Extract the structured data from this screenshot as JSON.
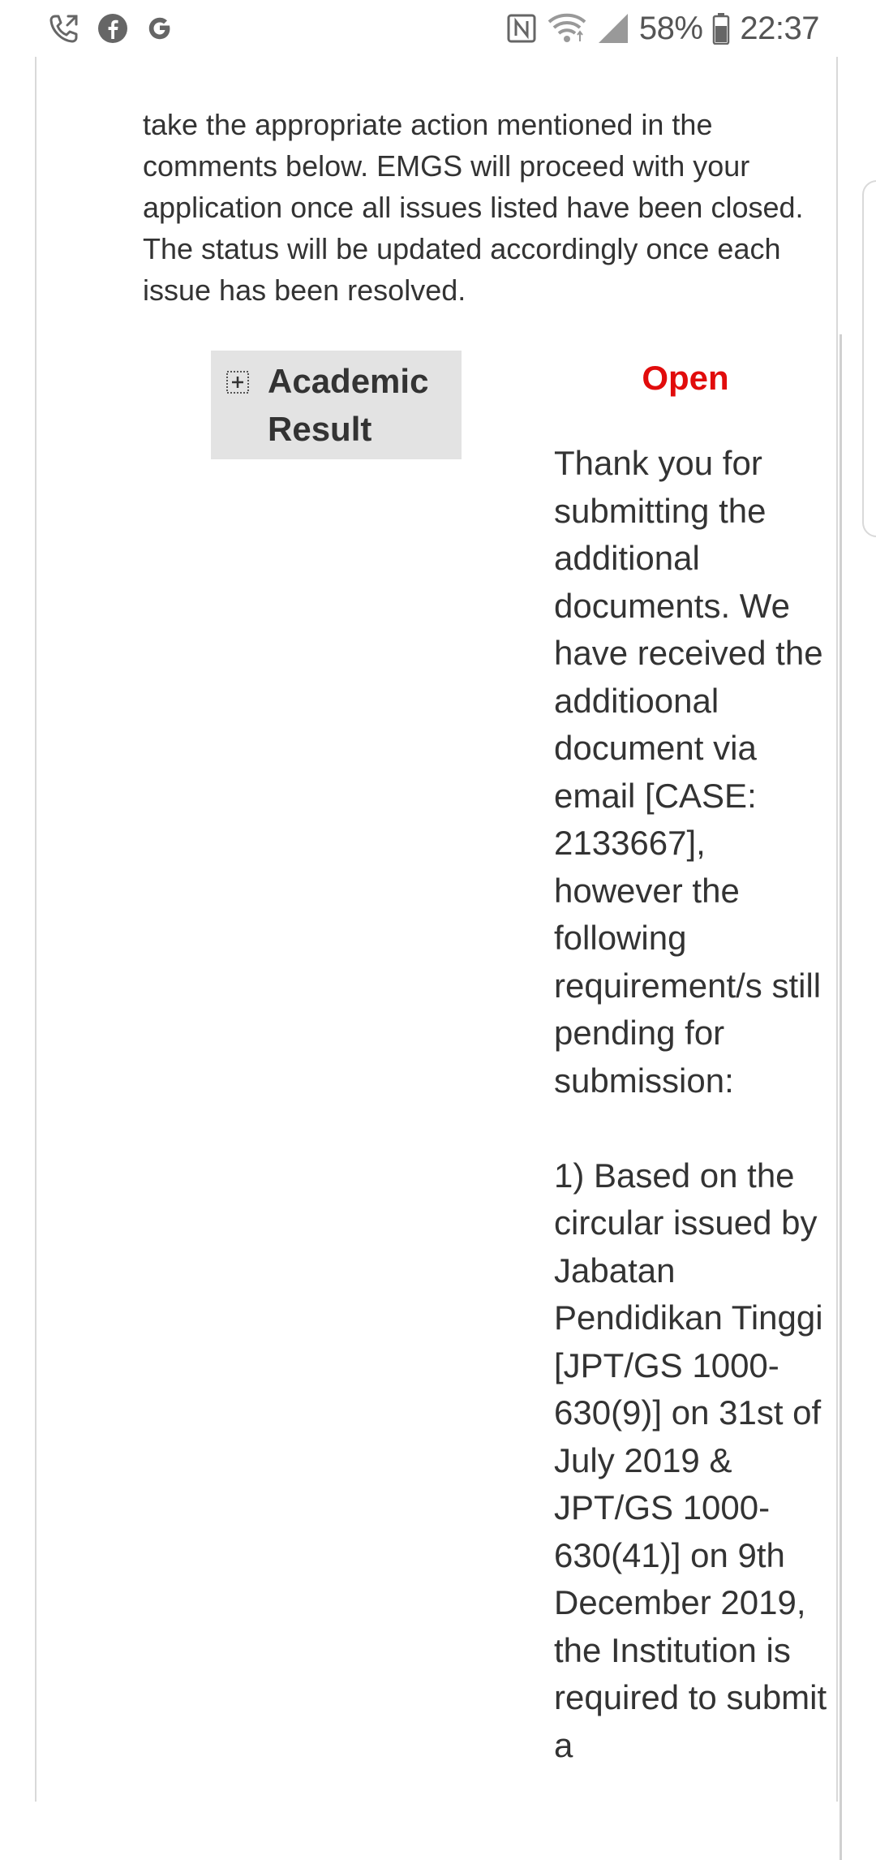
{
  "status_bar": {
    "battery_percent": "58%",
    "time": "22:37",
    "left_icons": [
      "call-forward-icon",
      "facebook-icon",
      "google-icon"
    ],
    "right_icons": [
      "nfc-icon",
      "wifi-icon",
      "signal-icon",
      "battery-icon"
    ]
  },
  "intro": {
    "text": "take the appropriate action mentioned in the comments below. EMGS will proceed with your application once all issues listed have been closed. The status will be updated accordingly once each issue has been resolved."
  },
  "issue": {
    "title": "Academic Result",
    "status": "Open",
    "status_color": "#e10c0c",
    "comment": "Thank you for submitting the additional documents. We have received the additioonal document via email [CASE: 2133667], however the following requirement/s still pending for submission:\n\n1) Based on the circular issued by Jabatan Pendidikan Tinggi [JPT/GS 1000-630(9)] on 31st of July 2019 & JPT/GS 1000-630(41)] on 9th December 2019, the Institution is required to submit a"
  }
}
